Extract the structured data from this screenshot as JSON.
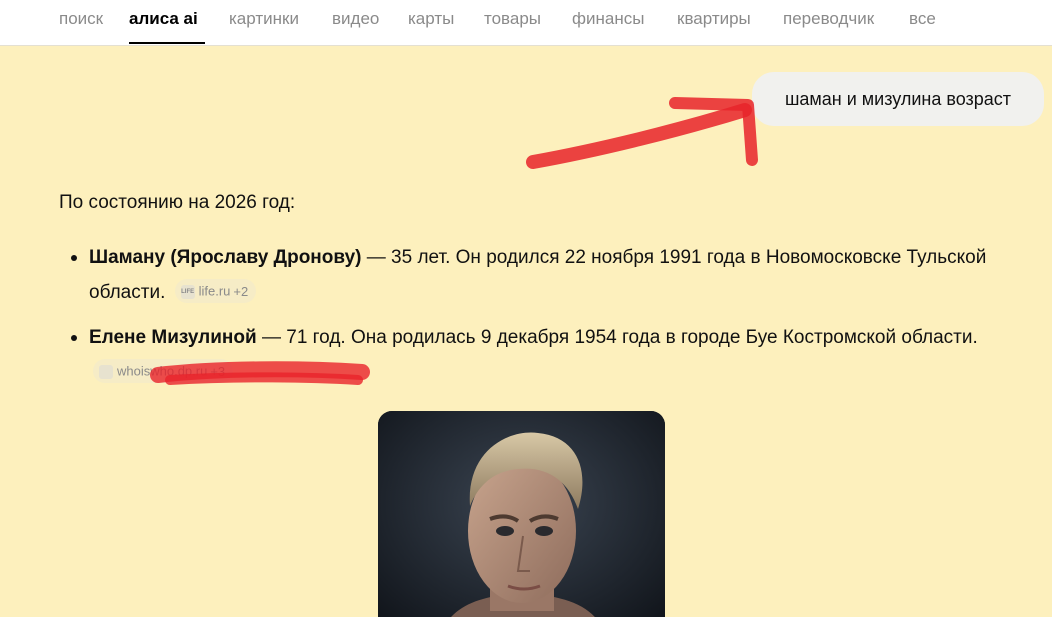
{
  "nav": {
    "tabs": [
      {
        "label": "поиск"
      },
      {
        "label": "алиса ai"
      },
      {
        "label": "картинки"
      },
      {
        "label": "видео"
      },
      {
        "label": "карты"
      },
      {
        "label": "товары"
      },
      {
        "label": "финансы"
      },
      {
        "label": "квартиры"
      },
      {
        "label": "переводчик"
      },
      {
        "label": "все"
      }
    ],
    "active_tab": "алиса ai"
  },
  "chat": {
    "user_query": "шаман и мизулина возраст",
    "answer": {
      "intro": "По состоянию на 2026 год:",
      "items": [
        {
          "bold": "Шаману (Ярославу Дронову)",
          "text": " — 35 лет. Он родился 22 ноября 1991 года в Новомосковске Тульской области.",
          "source": {
            "icon_text": "LIFE",
            "name": "life.ru",
            "count": "+2"
          }
        },
        {
          "bold": "Елене Мизулиной",
          "text": " — 71 год. Она родилась 9 декабря 1954 года в городе Буе Костромской области.",
          "source": {
            "icon_text": "",
            "name": "whoiswho.dp.ru",
            "count": "+3"
          }
        }
      ]
    }
  },
  "colors": {
    "background": "#fdf0bd",
    "annotation_red": "#e8232a",
    "active_tab": "#000000",
    "inactive_tab": "#8a8a8a"
  },
  "icons": {
    "source_chip_icon": "site-favicon-icon",
    "annotation": "red-arrow-marker"
  }
}
